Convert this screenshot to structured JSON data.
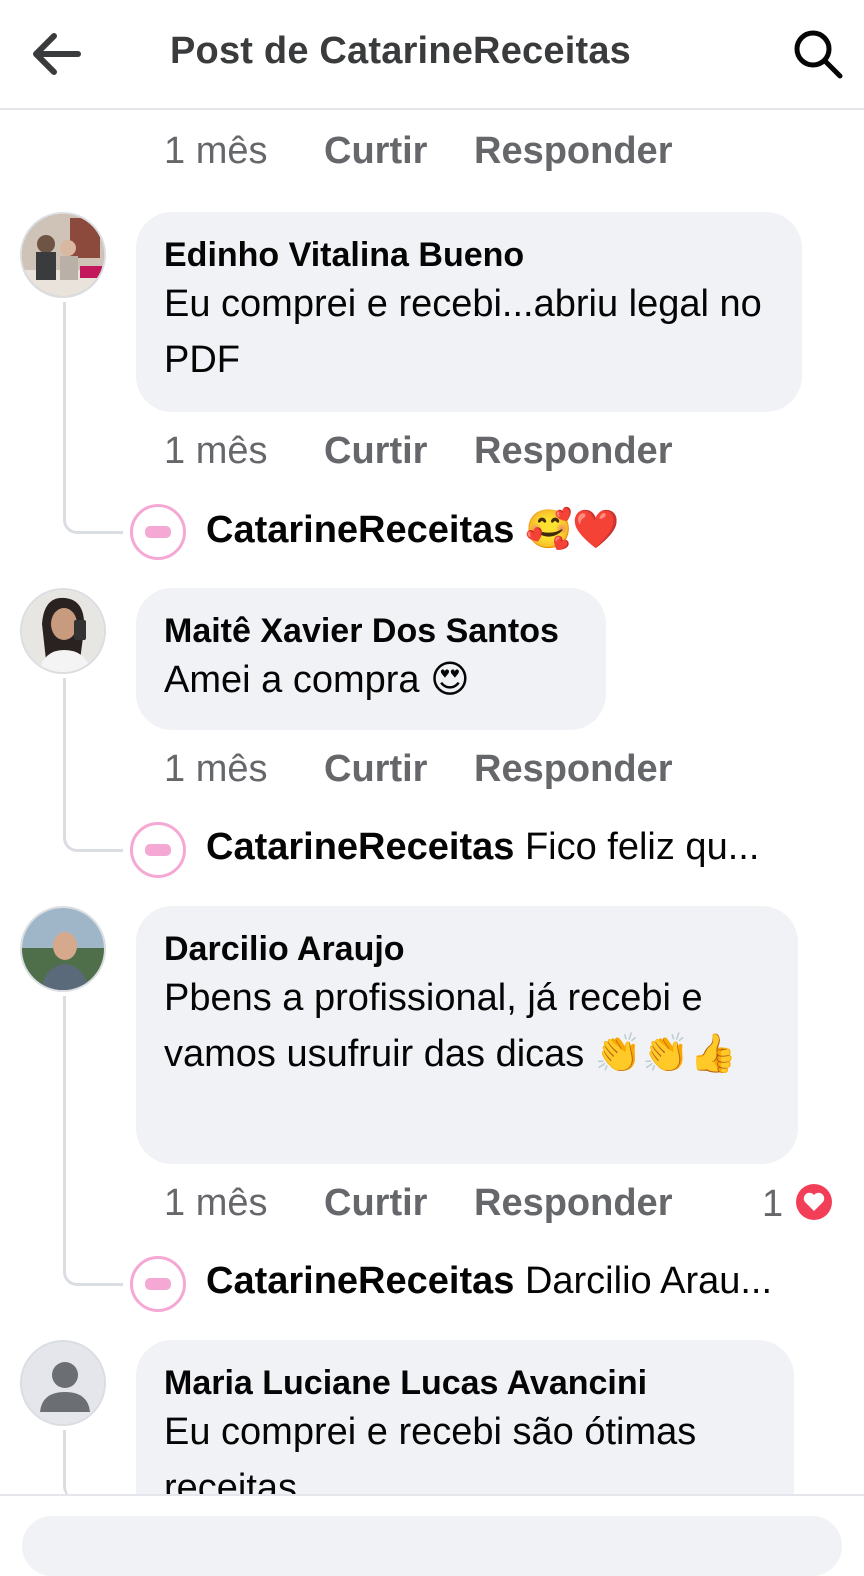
{
  "header": {
    "title": "Post de CatarineReceitas"
  },
  "actions": {
    "time": "1 mês",
    "like": "Curtir",
    "reply": "Responder"
  },
  "comments": [
    {
      "author": "Edinho Vitalina Bueno",
      "text": "Eu comprei e recebi...abriu legal no PDF",
      "reply": {
        "author": "CatarineReceitas",
        "text": "🥰❤️"
      }
    },
    {
      "author": "Maitê Xavier Dos Santos",
      "text": "Amei a compra 😍",
      "reply": {
        "author": "CatarineReceitas",
        "text": "Fico feliz qu..."
      }
    },
    {
      "author": "Darcilio Araujo",
      "text": "Pbens a profissional, já recebi e vamos usufruir das dicas 👏👏👍",
      "reactions": "1",
      "reply": {
        "author": "CatarineReceitas",
        "text": "Darcilio Arau..."
      }
    },
    {
      "author": "Maria Luciane Lucas Avancini",
      "text": "Eu comprei e recebi são ótimas receitas"
    }
  ],
  "colors": {
    "reaction": "#f33e58",
    "brand_pink": "#f5a8d4"
  }
}
